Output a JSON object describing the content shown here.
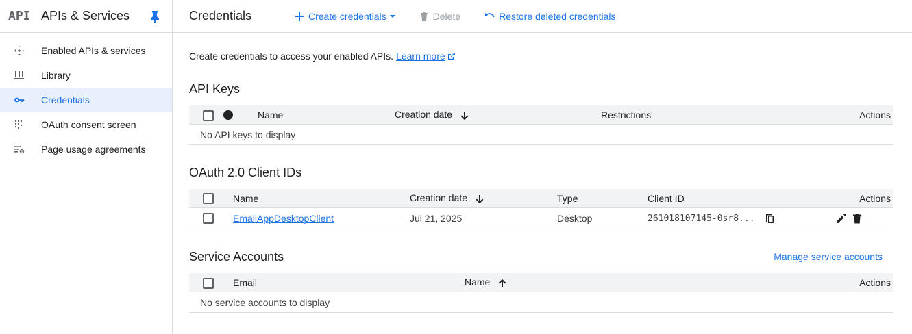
{
  "sidebar": {
    "logo": "API",
    "title": "APIs & Services",
    "items": [
      {
        "label": "Enabled APIs & services",
        "icon": "api-diamond-icon"
      },
      {
        "label": "Library",
        "icon": "library-icon"
      },
      {
        "label": "Credentials",
        "icon": "key-icon",
        "active": true
      },
      {
        "label": "OAuth consent screen",
        "icon": "oauth-dots-icon"
      },
      {
        "label": "Page usage agreements",
        "icon": "settings-list-icon"
      }
    ]
  },
  "header": {
    "title": "Credentials",
    "create_label": "Create credentials",
    "delete_label": "Delete",
    "restore_label": "Restore deleted credentials"
  },
  "intro": {
    "text": "Create credentials to access your enabled APIs.",
    "learn_more": "Learn more"
  },
  "api_keys": {
    "title": "API Keys",
    "columns": [
      "Name",
      "Creation date",
      "Restrictions",
      "Actions"
    ],
    "empty": "No API keys to display"
  },
  "oauth": {
    "title": "OAuth 2.0 Client IDs",
    "columns": [
      "Name",
      "Creation date",
      "Type",
      "Client ID",
      "Actions"
    ],
    "rows": [
      {
        "name": "EmailAppDesktopClient",
        "date": "Jul 21, 2025",
        "type": "Desktop",
        "client_id": "261018107145-0sr8..."
      }
    ]
  },
  "service_accounts": {
    "title": "Service Accounts",
    "manage_label": "Manage service accounts",
    "columns": [
      "Email",
      "Name",
      "Actions"
    ],
    "empty": "No service accounts to display"
  },
  "colors": {
    "accent": "#1a73e8",
    "active_bg": "#e8f0fe",
    "header_bg": "#f1f3f4"
  }
}
